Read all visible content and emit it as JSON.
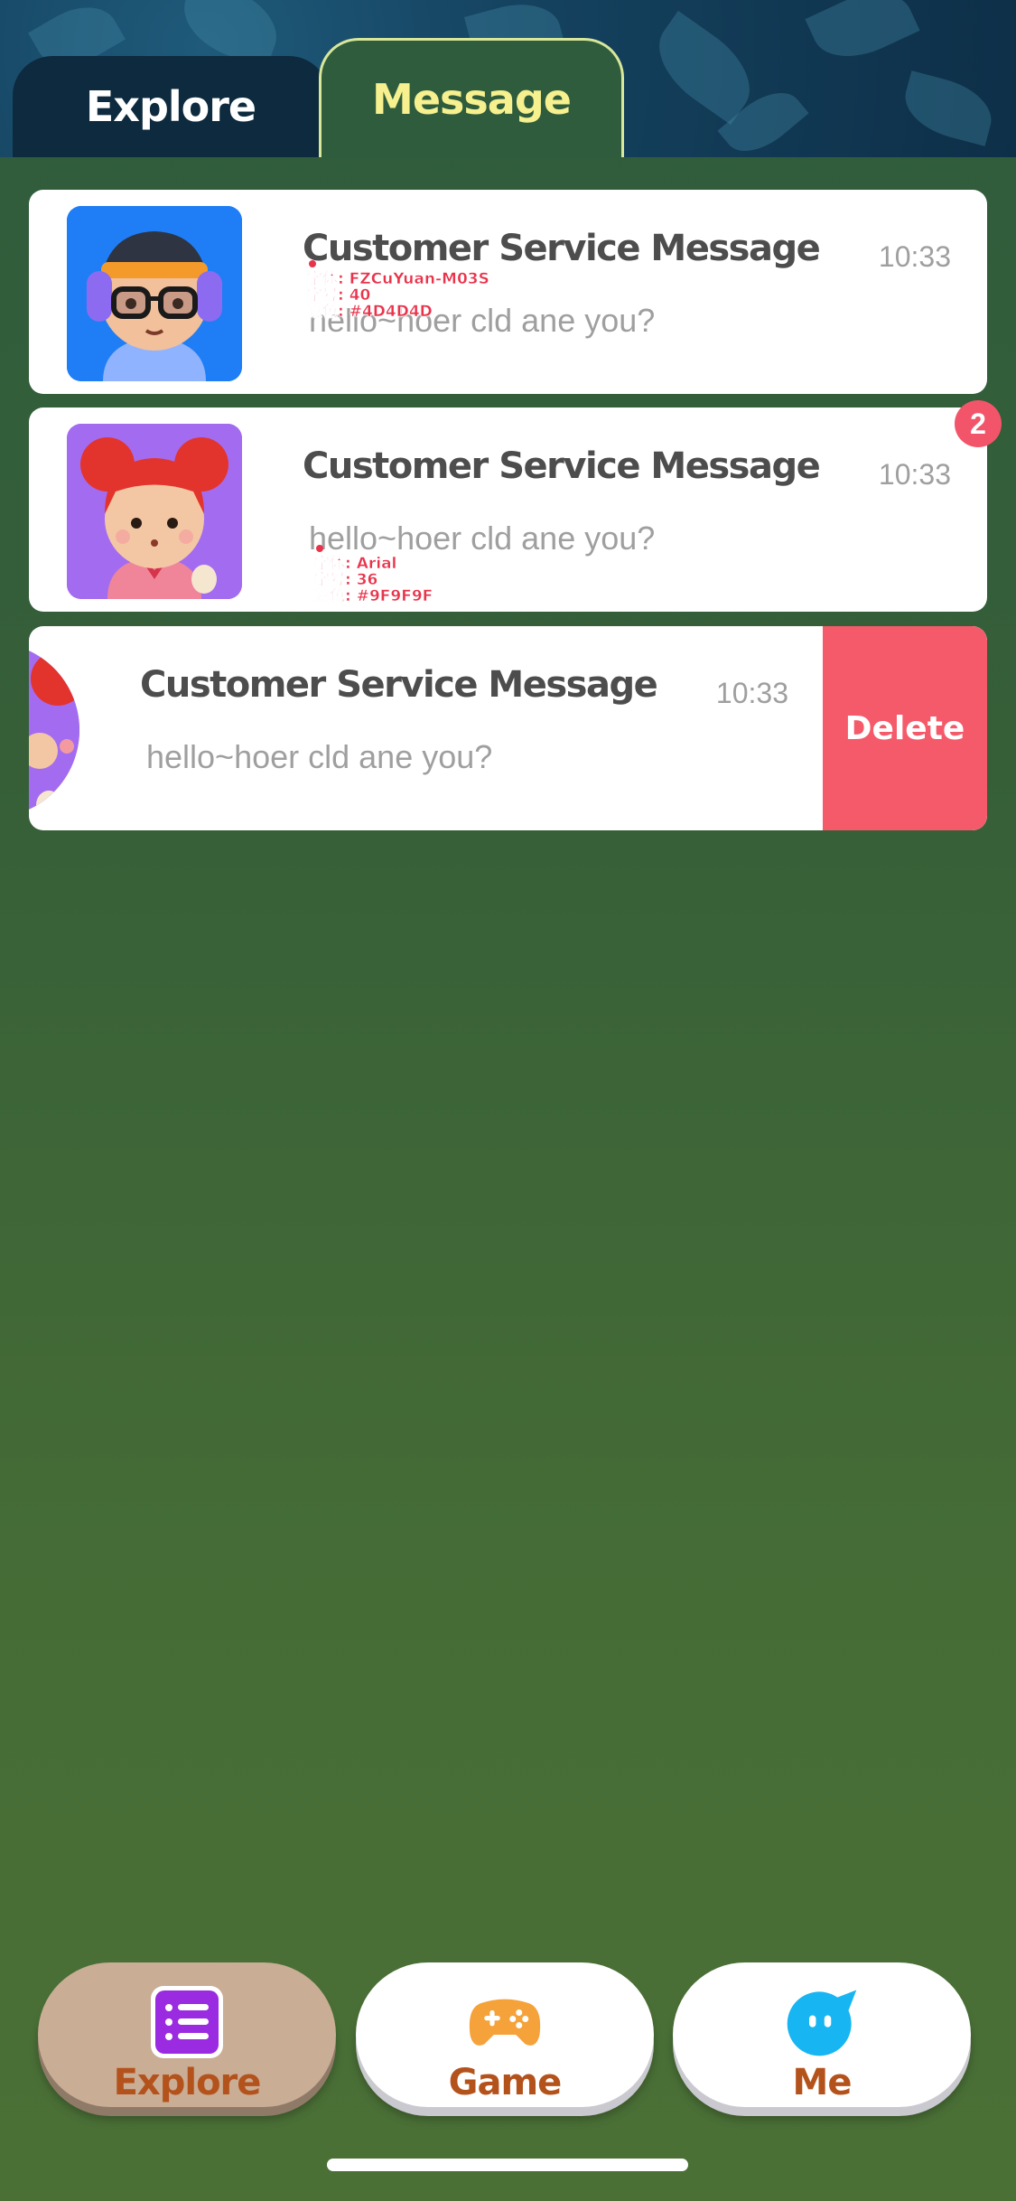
{
  "header": {
    "tabs": [
      {
        "label": "Explore",
        "active": false
      },
      {
        "label": "Message",
        "active": true
      }
    ]
  },
  "messages": [
    {
      "title": "Customer Service Message",
      "time": "10:33",
      "preview": "hello~hoer cld ane you?",
      "avatar": "boy-with-headphones-avatar",
      "annotation": [
        "字体: FZCuYuan-M03S",
        "字号: 40",
        "颜色: #4D4D4D"
      ]
    },
    {
      "title": "Customer Service Message",
      "time": "10:33",
      "preview": "hello~hoer cld ane you?",
      "avatar": "girl-red-hair-avatar",
      "badge": "2",
      "annotation": [
        "字体: Arial",
        "字号: 36",
        "颜色: #9F9F9F"
      ]
    },
    {
      "title": "Customer Service Message",
      "time": "10:33",
      "preview": "hello~hoer cld ane you?",
      "avatar": "girl-red-hair-avatar",
      "action": "Delete"
    }
  ],
  "bottom_nav": {
    "items": [
      {
        "label": "Explore",
        "icon": "list-icon",
        "active": true
      },
      {
        "label": "Game",
        "icon": "gamepad-icon",
        "active": false
      },
      {
        "label": "Me",
        "icon": "chat-bubble-face-icon",
        "active": false
      }
    ]
  },
  "colors": {
    "title_text": "#4D4D4D",
    "preview_text": "#9F9F9F",
    "badge": "#F2556A",
    "delete": "#F45A6A",
    "active_tab_text": "#F6F08E"
  }
}
